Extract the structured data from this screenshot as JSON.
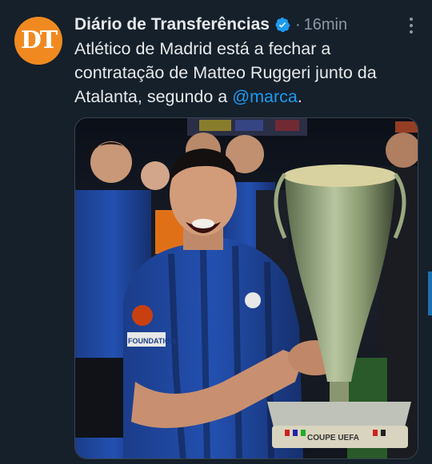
{
  "post": {
    "author_name": "Diário de Transferências",
    "avatar_initials": "DT",
    "separator": "·",
    "timestamp": "16min",
    "text_before_mention": "Atlético de Madrid está a fechar a contratação de Matteo Ruggeri junto da Atalanta, segundo a ",
    "mention": "@marca",
    "text_after_mention": "."
  },
  "photo": {
    "trophy_inscription": "COUPE UEFA",
    "sleeve_patch": "FOUNDATION"
  },
  "colors": {
    "background": "#15202b",
    "accent_link": "#1d9bf0",
    "avatar_orange": "#f08a20",
    "muted_text": "#8b98a5"
  },
  "icons": [
    "verified-badge-icon",
    "more-options-icon"
  ]
}
